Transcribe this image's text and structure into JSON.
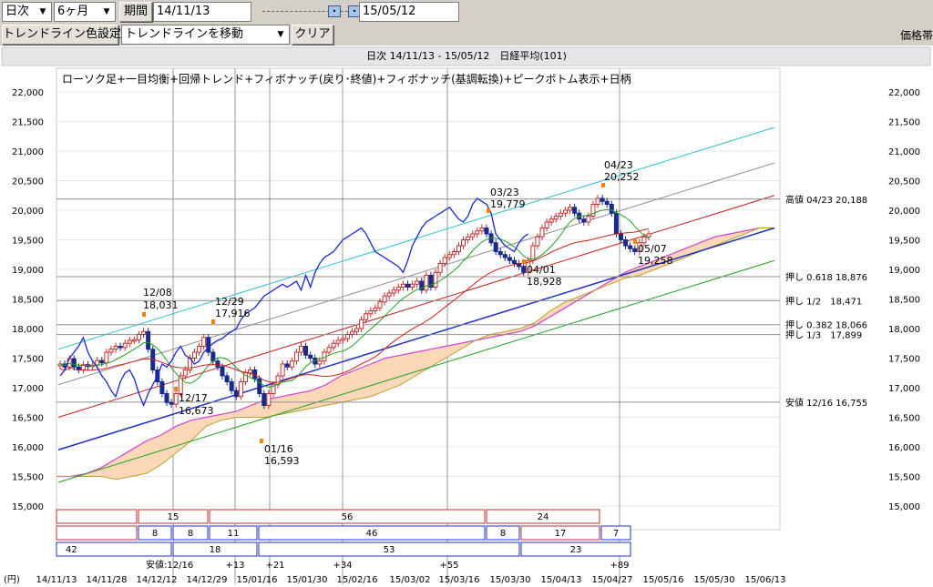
{
  "toolbar1": {
    "period_type": "日次",
    "range": "6ヶ月",
    "period_button": "期間",
    "start_date": "14/11/13",
    "end_date": "15/05/12"
  },
  "toolbar2": {
    "trendline_color_button": "トレンドライン色設定",
    "trendline_mode": "トレンドラインを移動",
    "clear_button": "クリア",
    "price_band_label": "価格帯"
  },
  "chart_data": {
    "type": "candlestick",
    "title": "日次 14/11/13 - 15/05/12　日経平均(101)",
    "subtitle": "ローソク足+一目均衡+回帰トレンド+フィボナッチ(戻り･終値)+フィボナッチ(基調転換)+ピークボトム表示+日柄",
    "y_unit": "(円)",
    "ylim": [
      14600,
      22400
    ],
    "y_ticks": [
      22000,
      21500,
      21000,
      20500,
      20000,
      19500,
      19000,
      18500,
      18000,
      17500,
      17000,
      16500,
      16000,
      15500,
      15000
    ],
    "y_tick_labels": [
      "22,000",
      "21,500",
      "21,000",
      "20,500",
      "20,000",
      "19,500",
      "19,000",
      "18,500",
      "18,000",
      "17,500",
      "17,000",
      "16,500",
      "16,000",
      "15,500",
      "15,000"
    ],
    "x_tick_labels": [
      "14/11/13",
      "14/11/28",
      "14/12/12",
      "14/12/29",
      "15/01/16",
      "15/01/30",
      "15/02/16",
      "15/03/02",
      "15/03/16",
      "15/03/30",
      "15/04/13",
      "15/04/27",
      "15/05/16",
      "15/05/30",
      "15/06/13"
    ],
    "vertical_markers": [
      "12/16",
      "+13",
      "+21",
      "+34",
      "+55",
      "+89"
    ],
    "closes": [
      17400,
      17350,
      17490,
      17350,
      17300,
      17390,
      17360,
      17380,
      17460,
      17420,
      17600,
      17650,
      17700,
      17680,
      17750,
      17800,
      17810,
      17900,
      17950,
      17650,
      17300,
      17100,
      16900,
      16750,
      16720,
      16900,
      17200,
      17300,
      17500,
      17600,
      17700,
      17850,
      17600,
      17450,
      17350,
      17200,
      17100,
      16950,
      16850,
      17100,
      17250,
      17300,
      17150,
      16900,
      16700,
      16900,
      17050,
      17200,
      17400,
      17350,
      17450,
      17600,
      17700,
      17550,
      17500,
      17400,
      17450,
      17600,
      17680,
      17750,
      17800,
      17830,
      17900,
      17950,
      18000,
      18150,
      18250,
      18300,
      18350,
      18450,
      18550,
      18600,
      18650,
      18700,
      18750,
      18700,
      18750,
      18800,
      18650,
      18900,
      18700,
      18950,
      19100,
      19200,
      19250,
      19300,
      19400,
      19500,
      19550,
      19600,
      19650,
      19700,
      19600,
      19450,
      19300,
      19250,
      19200,
      19150,
      19100,
      19050,
      18950,
      19150,
      19400,
      19550,
      19700,
      19800,
      19850,
      19900,
      19950,
      20000,
      20050,
      19950,
      19850,
      19800,
      19900,
      20100,
      20200,
      20150,
      20100,
      19950,
      19600,
      19500,
      19400,
      19350,
      19300,
      19450,
      19550,
      19600
    ],
    "regression": {
      "start_value": 15950,
      "end_value": 19700
    },
    "regression_channels": [
      {
        "offset": 1700
      },
      {
        "offset": 1100
      },
      {
        "offset": 550
      },
      {
        "offset": -550
      }
    ],
    "cloud": {
      "upper": [
        15500,
        15500,
        15550,
        15650,
        15800,
        15950,
        16100,
        16200,
        16350,
        16450,
        16500,
        16550,
        16600,
        16700,
        16800,
        16850,
        16900,
        16950,
        17050,
        17200,
        17300,
        17400,
        17500,
        17550,
        17600,
        17650,
        17700,
        17750,
        17800,
        17850,
        17900,
        17950,
        18050,
        18200,
        18350,
        18500,
        18650,
        18800,
        18950,
        19050,
        19150,
        19250,
        19350,
        19450,
        19550,
        19600,
        19650,
        19700,
        19700
      ],
      "lower": [
        15500,
        15500,
        15500,
        15500,
        15450,
        15500,
        15550,
        15700,
        15900,
        16100,
        16350,
        16450,
        16500,
        16500,
        16500,
        16550,
        16600,
        16650,
        16700,
        16750,
        16800,
        16850,
        16950,
        17050,
        17200,
        17350,
        17500,
        17650,
        17800,
        17900,
        17950,
        18000,
        18100,
        18300,
        18450,
        18550,
        18650,
        18750,
        18850,
        18900,
        19000,
        19100,
        19200,
        19300,
        19400,
        19500,
        19600,
        19700,
        19700
      ]
    },
    "annotations": [
      {
        "label": "12/08",
        "value": "18,031"
      },
      {
        "label": "12/17",
        "value": "16,673"
      },
      {
        "label": "12/29",
        "value": "17,916"
      },
      {
        "label": "01/16",
        "value": "16,593"
      },
      {
        "label": "03/23",
        "value": "19,779"
      },
      {
        "label": "04/01",
        "value": "18,928"
      },
      {
        "label": "04/23",
        "value": "20,252"
      },
      {
        "label": "05/07",
        "value": "19,258"
      }
    ],
    "fib_levels": [
      {
        "label": "高値 04/23 20,188",
        "value": 20188
      },
      {
        "label": "押し 0.618 18,876",
        "value": 18876
      },
      {
        "label": "押し 1/2　18,471",
        "value": 18471
      },
      {
        "label": "押し 0.382 18,066",
        "value": 18066
      },
      {
        "label": "押し 1/3　17,899",
        "value": 17899
      },
      {
        "label": "安値 12/16 16,755",
        "value": 16755
      }
    ],
    "day_count_rows": [
      [
        "15",
        "56",
        "24"
      ],
      [
        "8",
        "8",
        "11",
        "46",
        "8",
        "17",
        "7"
      ],
      [
        "42",
        "18",
        "53",
        "23"
      ]
    ],
    "low_marker_label": "安値:12/16",
    "grid": true
  }
}
